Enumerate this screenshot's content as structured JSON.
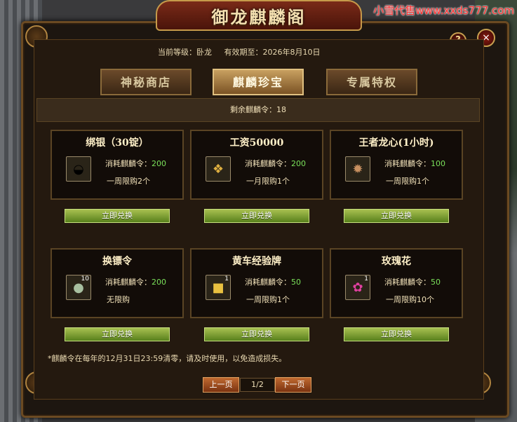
{
  "watermark": "小雪代售www.xxds777.com",
  "window": {
    "title": "御龙麒麟阁"
  },
  "info": {
    "level_label": "当前等级：卧龙",
    "expiry_label": "有效期至：2026年8月10日"
  },
  "tabs": [
    {
      "label": "神秘商店",
      "active": false
    },
    {
      "label": "麒麟珍宝",
      "active": true
    },
    {
      "label": "专属特权",
      "active": false
    }
  ],
  "remaining": "剩余麒麟令：18",
  "cost_prefix": "消耗麒麟令：",
  "exchange_label": "立即兑换",
  "items": [
    {
      "title": "绑银（30锭）",
      "cost": "200",
      "limit": "一周限购2个",
      "icon": "silver-ingot-icon",
      "count": ""
    },
    {
      "title": "工资50000",
      "cost": "200",
      "limit": "一月限购1个",
      "icon": "salary-scroll-icon",
      "count": ""
    },
    {
      "title": "王者龙心(1小时)",
      "cost": "100",
      "limit": "一周限购1个",
      "icon": "dragon-heart-icon",
      "count": ""
    },
    {
      "title": "换镖令",
      "cost": "200",
      "limit": "无限购",
      "icon": "escort-token-icon",
      "count": "10"
    },
    {
      "title": "黄车经验牌",
      "cost": "50",
      "limit": "一周限购1个",
      "icon": "gold-cart-icon",
      "count": "1"
    },
    {
      "title": "玫瑰花",
      "cost": "50",
      "limit": "一周限购10个",
      "icon": "rose-icon",
      "count": "1"
    }
  ],
  "note": "*麒麟令在每年的12月31日23:59清零，请及时使用，以免造成损失。",
  "pager": {
    "prev": "上一页",
    "page": "1/2",
    "next": "下一页"
  },
  "buttons": {
    "help": "?",
    "close": "×"
  },
  "colors": {
    "accent_green": "#7ae05a",
    "button_green": "#88a838",
    "frame_gold": "#c69a4a"
  }
}
